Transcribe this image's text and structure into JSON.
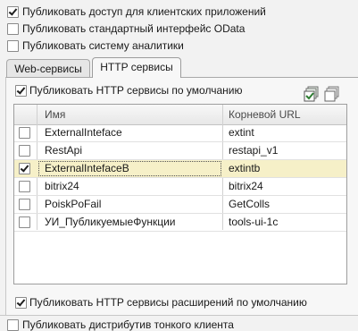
{
  "top_options": [
    {
      "label": "Публиковать доступ для клиентских приложений",
      "checked": true
    },
    {
      "label": "Публиковать стандартный интерфейс OData",
      "checked": false
    },
    {
      "label": "Публиковать систему аналитики",
      "checked": false
    }
  ],
  "tabs": [
    {
      "label": "Web-сервисы",
      "active": false
    },
    {
      "label": "HTTP сервисы",
      "active": true
    }
  ],
  "http": {
    "publish_default_label": "Публиковать HTTP сервисы по умолчанию",
    "publish_default_checked": true,
    "publish_ext_label": "Публиковать HTTP сервисы расширений по умолчанию",
    "publish_ext_checked": true
  },
  "toolbar": {
    "icons": [
      "check-all-icon",
      "uncheck-all-icon"
    ]
  },
  "table": {
    "columns": [
      "Имя",
      "Корневой URL"
    ],
    "rows": [
      {
        "checked": false,
        "name": "ExternalInteface",
        "url": "extint",
        "selected": false
      },
      {
        "checked": false,
        "name": "RestApi",
        "url": "restapi_v1",
        "selected": false
      },
      {
        "checked": true,
        "name": "ExternalIntefaceB",
        "url": "extintb",
        "selected": true
      },
      {
        "checked": false,
        "name": "bitrix24",
        "url": "bitrix24",
        "selected": false
      },
      {
        "checked": false,
        "name": "PoiskPoFail",
        "url": "GetColls",
        "selected": false
      },
      {
        "checked": false,
        "name": "УИ_ПубликуемыеФункции",
        "url": "tools-ui-1c",
        "selected": false
      }
    ]
  },
  "bottom_option": {
    "label": "Публиковать дистрибутив тонкого клиента",
    "checked": false
  }
}
